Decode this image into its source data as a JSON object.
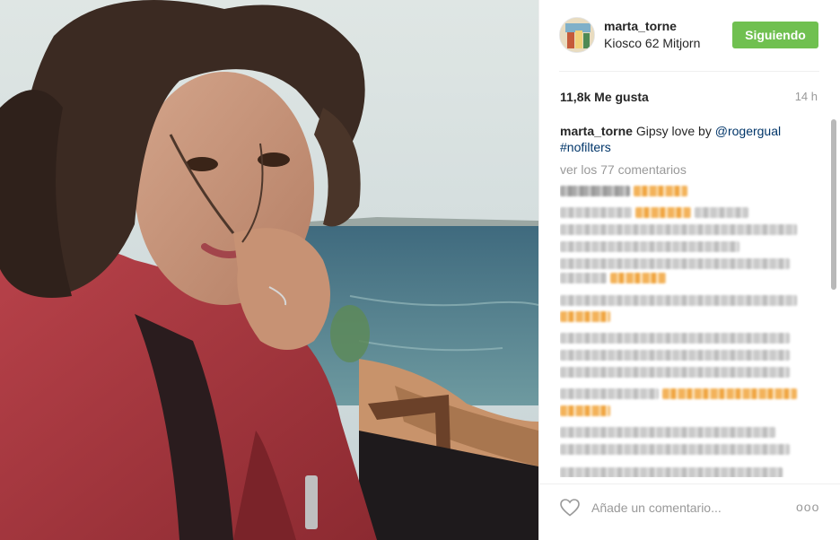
{
  "post": {
    "image_alt": "",
    "user": {
      "username": "marta_torne",
      "location": "Kiosco 62 Mitjorn",
      "follow_label": "Siguiendo"
    },
    "likes": "11,8k Me gusta",
    "time_ago": "14 h",
    "caption": {
      "username": "marta_torne",
      "text": "Gipsy love  by ",
      "mention": "@rogergual",
      "hashtag": "#nofilters"
    },
    "view_all_comments": "ver los 77 comentarios",
    "comment_placeholder": "Añade un comentario...",
    "more_label": "ooo"
  },
  "colors": {
    "follow_button": "#70c050",
    "link": "#003569",
    "muted": "#999999"
  },
  "icons": {
    "like": "heart-outline-icon",
    "more": "ellipsis-icon"
  }
}
